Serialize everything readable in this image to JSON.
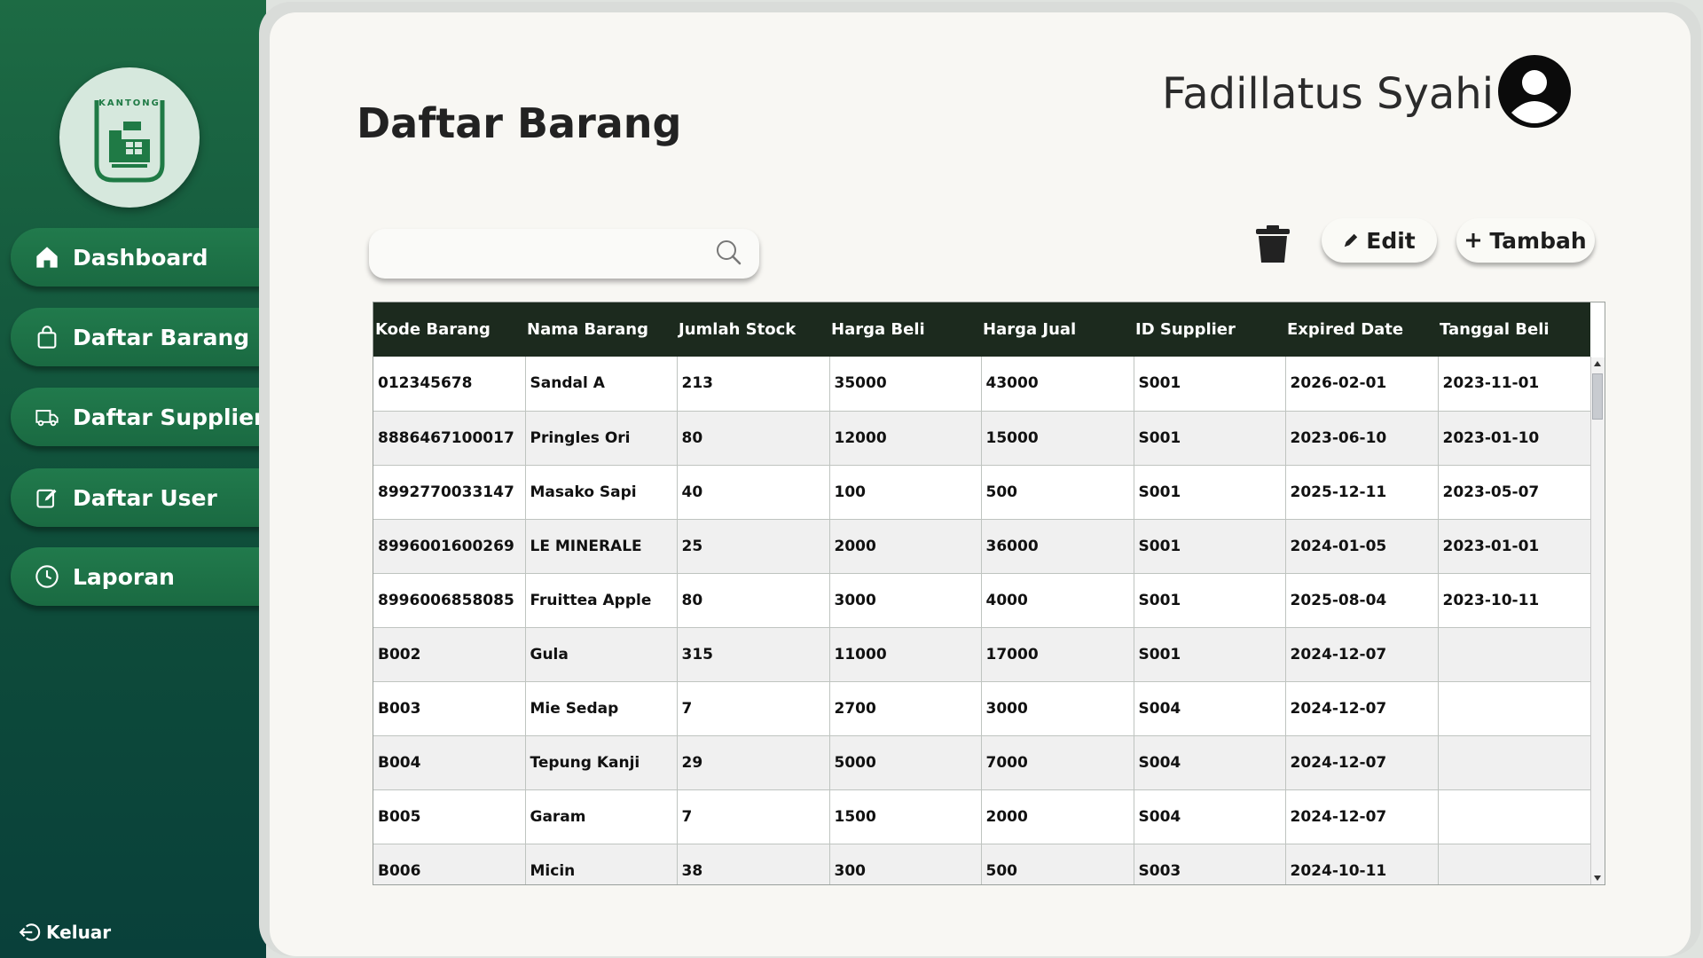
{
  "sidebar": {
    "logo_text": "KANTONG",
    "items": [
      {
        "label": "Dashboard",
        "icon": "home-icon"
      },
      {
        "label": "Daftar Barang",
        "icon": "shopping-bag-icon"
      },
      {
        "label": "Daftar Supplier",
        "icon": "truck-icon"
      },
      {
        "label": "Daftar User",
        "icon": "edit-icon"
      },
      {
        "label": "Laporan",
        "icon": "clock-icon"
      }
    ],
    "logout_label": "Keluar"
  },
  "header": {
    "title": "Daftar Barang",
    "username": "Fadillatus Syahi"
  },
  "toolbar": {
    "search_value": "",
    "edit_label": "Edit",
    "add_label": "Tambah"
  },
  "table": {
    "columns": [
      "Kode Barang",
      "Nama Barang",
      "Jumlah Stock",
      "Harga Beli",
      "Harga Jual",
      "ID Supplier",
      "Expired Date",
      "Tanggal Beli"
    ],
    "rows": [
      [
        "012345678",
        "Sandal A",
        "213",
        "35000",
        "43000",
        "S001",
        "2026-02-01",
        "2023-11-01"
      ],
      [
        "8886467100017",
        "Pringles Ori",
        "80",
        "12000",
        "15000",
        "S001",
        "2023-06-10",
        "2023-01-10"
      ],
      [
        "8992770033147",
        "Masako Sapi",
        "40",
        "100",
        "500",
        "S001",
        "2025-12-11",
        "2023-05-07"
      ],
      [
        "8996001600269",
        "LE MINERALE",
        "25",
        "2000",
        "36000",
        "S001",
        "2024-01-05",
        "2023-01-01"
      ],
      [
        "8996006858085",
        "Fruittea Apple",
        "80",
        "3000",
        "4000",
        "S001",
        "2025-08-04",
        "2023-10-11"
      ],
      [
        "B002",
        "Gula",
        "315",
        "11000",
        "17000",
        "S001",
        "2024-12-07",
        ""
      ],
      [
        "B003",
        "Mie Sedap",
        "7",
        "2700",
        "3000",
        "S004",
        "2024-12-07",
        ""
      ],
      [
        "B004",
        "Tepung Kanji",
        "29",
        "5000",
        "7000",
        "S004",
        "2024-12-07",
        ""
      ],
      [
        "B005",
        "Garam",
        "7",
        "1500",
        "2000",
        "S004",
        "2024-12-07",
        ""
      ],
      [
        "B006",
        "Micin",
        "38",
        "300",
        "500",
        "S003",
        "2024-10-11",
        ""
      ]
    ]
  },
  "colors": {
    "sidebar_top": "#1d6b44",
    "sidebar_bottom": "#09403a",
    "table_header": "#1c2a1e",
    "content_bg": "#f8f7f3"
  }
}
